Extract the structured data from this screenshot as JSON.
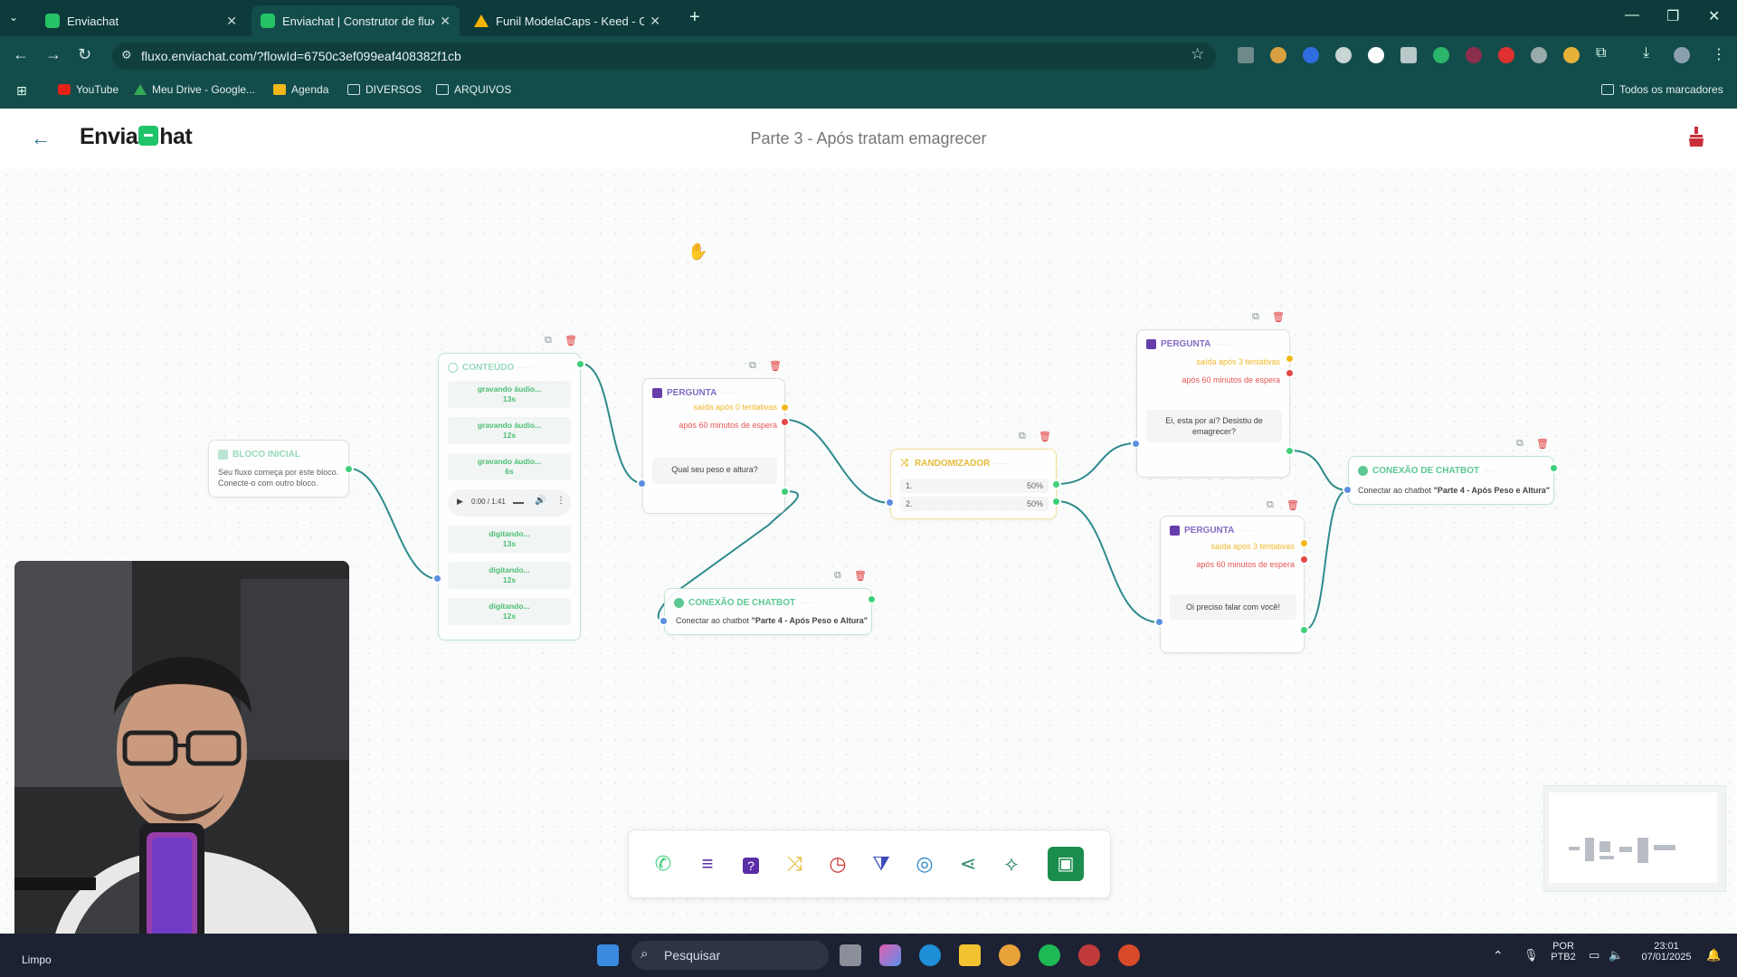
{
  "browser": {
    "tabs": [
      {
        "title": "Enviachat",
        "active": false
      },
      {
        "title": "Enviachat | Construtor de fluxo",
        "active": true
      },
      {
        "title": "Funil ModelaCaps - Keed - Goo",
        "active": false
      }
    ],
    "new_tab": "+",
    "url": "fluxo.enviachat.com/?flowId=6750c3ef099eaf408382f1cb",
    "bookmarks": [
      "YouTube",
      "Meu Drive - Google...",
      "Agenda",
      "DIVERSOS",
      "ARQUIVOS"
    ],
    "all_bookmarks": "Todos os marcadores"
  },
  "app": {
    "logo_left": "Envia",
    "logo_right": "hat",
    "flow_title": "Parte 3 - Após tratam emagrecer"
  },
  "nodes": {
    "start": {
      "title": "BLOCO INICIAL",
      "line1": "Seu fluxo começa por este bloco.",
      "line2": "Conecte-o com outro bloco."
    },
    "content": {
      "title": "CONTEÚDO",
      "items": [
        {
          "label": "gravando áudio...",
          "time": "13s"
        },
        {
          "label": "gravando áudio...",
          "time": "12s"
        },
        {
          "label": "gravando áudio...",
          "time": "6s"
        }
      ],
      "audio_time": "0:00 / 1:41",
      "typing": [
        {
          "label": "digitando...",
          "time": "13s"
        },
        {
          "label": "digitando...",
          "time": "12s"
        },
        {
          "label": "digitando...",
          "time": "12s"
        }
      ]
    },
    "question1": {
      "title": "PERGUNTA",
      "exit_attempts": "saída após 0 tentativas",
      "exit_wait": "após 60 minutos de espera",
      "question": "Qual seu peso e altura?"
    },
    "chatbot_conn1": {
      "title": "CONEXÃO DE CHATBOT",
      "text_prefix": "Conectar ao chatbot ",
      "text_target": "\"Parte 4 - Após Peso e Altura\""
    },
    "randomizer": {
      "title": "RANDOMIZADOR",
      "rows": [
        {
          "label": "1.",
          "value": "50%"
        },
        {
          "label": "2.",
          "value": "50%"
        }
      ]
    },
    "question2": {
      "title": "PERGUNTA",
      "exit_attempts": "saída após 3 tentativas",
      "exit_wait": "após 60 minutos de espera",
      "question_l1": "Ei, esta por aí? Desistiu de",
      "question_l2": "emagrecer?"
    },
    "question3": {
      "title": "PERGUNTA",
      "exit_attempts": "saída após 3 tentativas",
      "exit_wait": "após 60 minutos de espera",
      "question": "Oi preciso falar com você!"
    },
    "chatbot_conn2": {
      "title": "CONEXÃO DE CHATBOT",
      "text_prefix": "Conectar ao chatbot ",
      "text_target": "\"Parte 4 - Após Peso e Altura\""
    }
  },
  "toolbar": {
    "tools": [
      "whatsapp-icon",
      "menu-icon",
      "question-icon",
      "shuffle-icon",
      "clock-icon",
      "filter-icon",
      "target-icon",
      "share-icon",
      "webhook-icon"
    ],
    "save_icon": "save-icon"
  },
  "taskbar": {
    "weather": "Limpo",
    "search_placeholder": "Pesquisar",
    "lang1": "POR",
    "lang2": "PTB2",
    "time": "23:01",
    "date": "07/01/2025"
  },
  "colors": {
    "brand_green": "#1fc46a",
    "chrome_dark": "#0d3a3a",
    "chrome": "#134d4b",
    "edge": "#2e8b8b",
    "question_purple": "#5a2ea6",
    "warn_yellow": "#f2b71b",
    "danger_red": "#e44646"
  }
}
